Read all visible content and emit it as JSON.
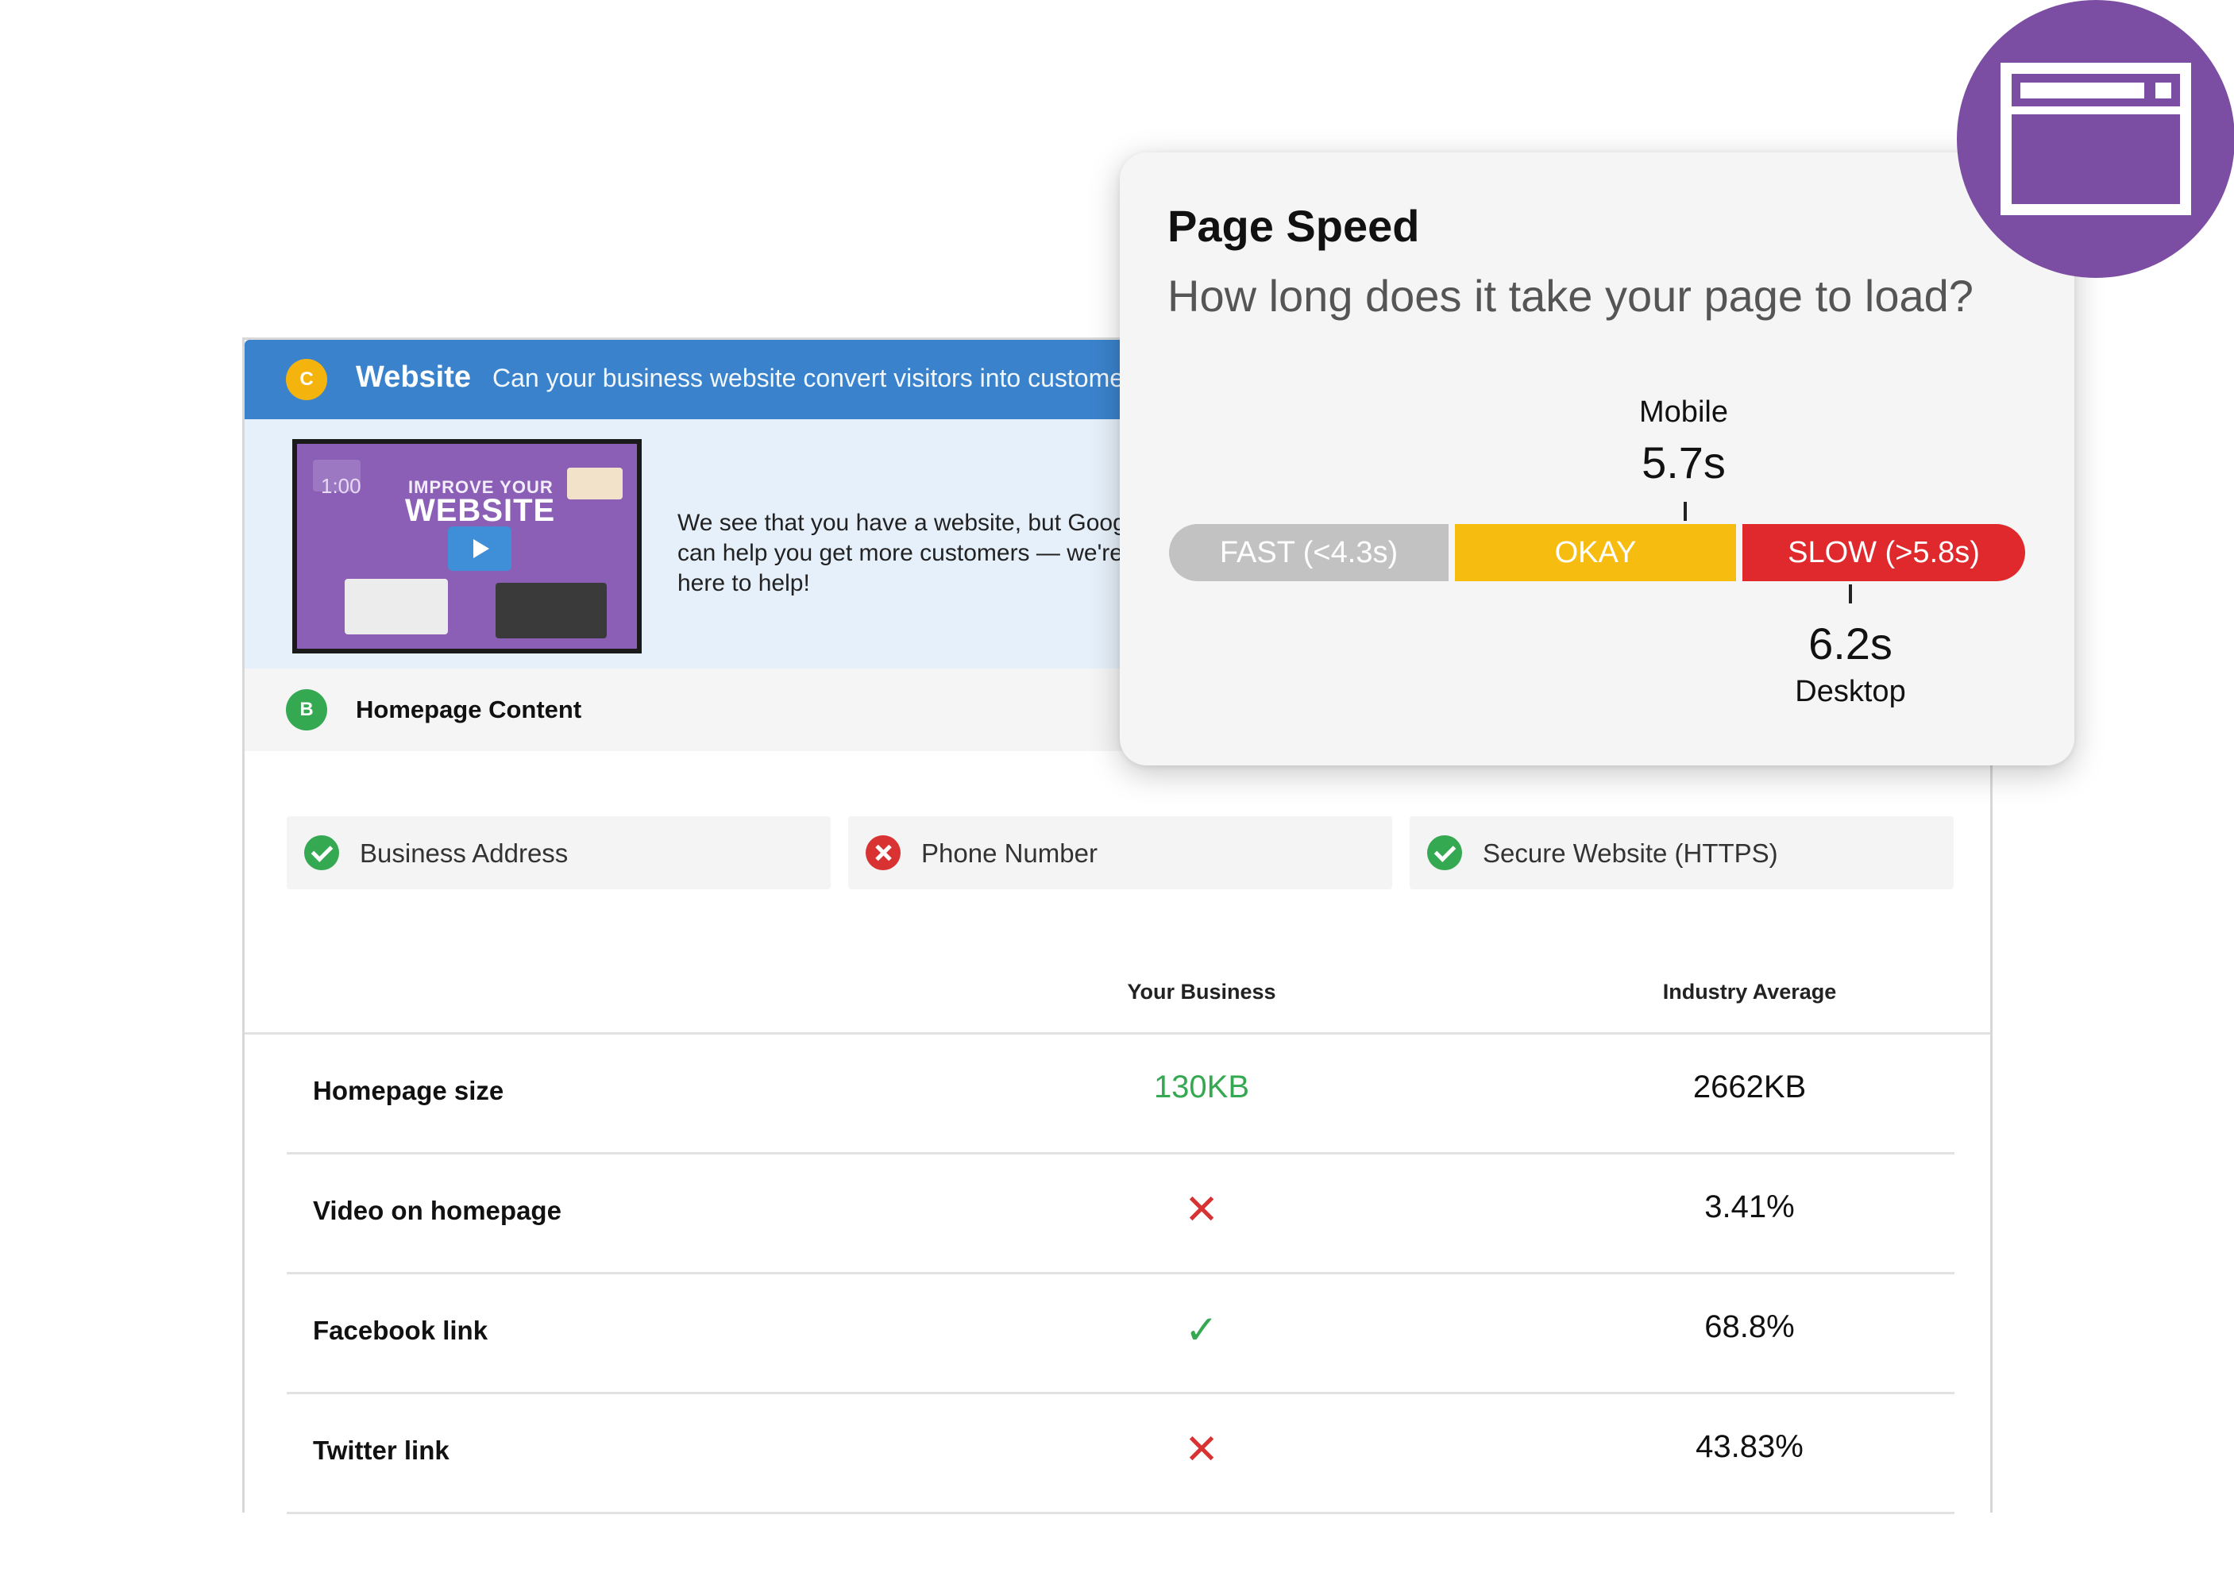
{
  "website_section": {
    "grade": "C",
    "title": "Website",
    "subtitle": "Can your business website convert visitors into customers?",
    "video": {
      "duration": "1:00",
      "caption_small": "IMPROVE YOUR",
      "caption_big": "WEBSITE"
    },
    "message": "We see that you have a website, but Google can help you get more customers — we're\nhere to help!"
  },
  "homepage_section": {
    "grade": "B",
    "title": "Homepage Content"
  },
  "checks": [
    {
      "label": "Business Address",
      "status": "pass"
    },
    {
      "label": "Phone Number",
      "status": "fail"
    },
    {
      "label": "Secure Website (HTTPS)",
      "status": "pass"
    }
  ],
  "comparison": {
    "col_yours": "Your Business",
    "col_average": "Industry Average",
    "rows": [
      {
        "label": "Homepage size",
        "yours": "130KB",
        "average": "2662KB"
      },
      {
        "label": "Video on homepage",
        "yours": "✕",
        "average": "3.41%"
      },
      {
        "label": "Facebook link",
        "yours": "✓",
        "average": "68.8%"
      },
      {
        "label": "Twitter link",
        "yours": "✕",
        "average": "43.83%"
      }
    ]
  },
  "page_speed": {
    "title": "Page Speed",
    "question": "How long does it take your page to load?",
    "segments": {
      "fast": "FAST (<4.3s)",
      "okay": "OKAY",
      "slow": "SLOW (>5.8s)"
    },
    "mobile": {
      "label": "Mobile",
      "value": "5.7s"
    },
    "desktop": {
      "label": "Desktop",
      "value": "6.2s"
    }
  },
  "colors": {
    "header_blue": "#3a83cc",
    "grade_c": "#f5b30e",
    "grade_b": "#35a852",
    "pass_green": "#35a852",
    "fail_red": "#d93232",
    "speed_fast": "#c2c2c2",
    "speed_okay": "#f6bd10",
    "speed_slow": "#e0292d",
    "badge_purple": "#7b4da3"
  },
  "icons": {
    "badge": "browser-window-icon",
    "pass": "check-circle-icon",
    "fail": "x-circle-icon"
  }
}
